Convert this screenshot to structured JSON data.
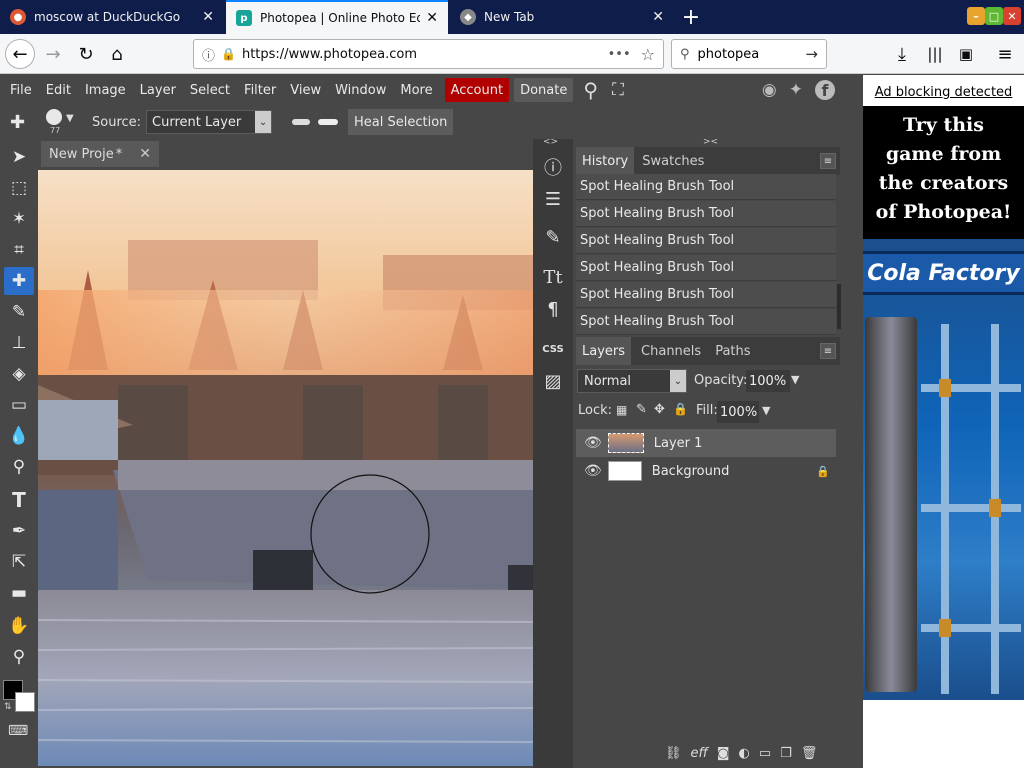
{
  "browser": {
    "tabs": [
      {
        "title": "moscow at DuckDuckGo",
        "active": false
      },
      {
        "title": "Photopea | Online Photo Edit",
        "active": true
      },
      {
        "title": "New Tab",
        "active": false
      }
    ],
    "url": "https://www.photopea.com",
    "search_value": "photopea"
  },
  "menu": {
    "items": [
      "File",
      "Edit",
      "Image",
      "Layer",
      "Select",
      "Filter",
      "View",
      "Window",
      "More"
    ],
    "account": "Account",
    "donate": "Donate"
  },
  "options": {
    "brush_size": "77",
    "source_label": "Source:",
    "source_value": "Current Layer",
    "heal_button": "Heal Selection"
  },
  "document": {
    "tab_title": "New Proje",
    "modified_mark": "*"
  },
  "history": {
    "tabs": [
      "History",
      "Swatches"
    ],
    "items": [
      "Spot Healing Brush Tool",
      "Spot Healing Brush Tool",
      "Spot Healing Brush Tool",
      "Spot Healing Brush Tool",
      "Spot Healing Brush Tool",
      "Spot Healing Brush Tool"
    ]
  },
  "layers": {
    "tabs": [
      "Layers",
      "Channels",
      "Paths"
    ],
    "blend_mode": "Normal",
    "opacity_label": "Opacity:",
    "opacity_value": "100%",
    "lock_label": "Lock:",
    "fill_label": "Fill:",
    "fill_value": "100%",
    "items": [
      {
        "name": "Layer 1",
        "selected": true
      },
      {
        "name": "Background",
        "locked": true
      }
    ]
  },
  "ad": {
    "notice": "Ad blocking detected",
    "headline": "Try this game from the creators of Photopea!",
    "game_title": "Cola Factory"
  },
  "colors": {
    "accent": "#0a84ff",
    "account_bg": "#b00000",
    "panel_bg": "#474747"
  }
}
